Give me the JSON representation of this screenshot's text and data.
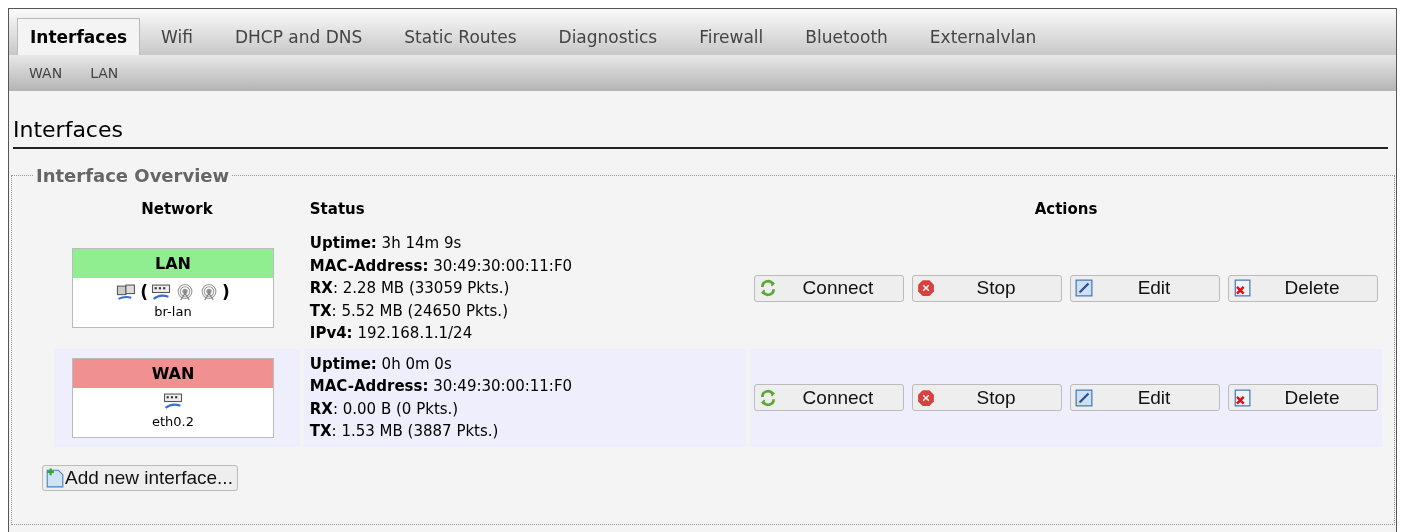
{
  "tabs": [
    {
      "label": "Interfaces",
      "selected": true
    },
    {
      "label": "Wifi",
      "selected": false
    },
    {
      "label": "DHCP and DNS",
      "selected": false
    },
    {
      "label": "Static Routes",
      "selected": false
    },
    {
      "label": "Diagnostics",
      "selected": false
    },
    {
      "label": "Firewall",
      "selected": false
    },
    {
      "label": "Bluetooth",
      "selected": false
    },
    {
      "label": "Externalvlan",
      "selected": false
    }
  ],
  "subtabs": [
    "WAN",
    "LAN"
  ],
  "page_title": "Interfaces",
  "overview": {
    "legend": "Interface Overview",
    "columns": [
      "Network",
      "Status",
      "Actions"
    ],
    "rows": [
      {
        "name": "LAN",
        "color": "#90ee90",
        "bridge": {
          "open": "(",
          "close": ")"
        },
        "devices": [
          {
            "kind": "ethernet"
          },
          {
            "kind": "wireless"
          },
          {
            "kind": "wireless"
          }
        ],
        "device_name": "br-lan",
        "status": [
          "**Uptime:** 3h 14m 9s",
          "**MAC-Address:** 30:49:30:00:11:F0",
          "**RX**: 2.28 MB (33059 Pkts.)",
          "**TX**: 5.52 MB (24650 Pkts.)",
          "**IPv4:** 192.168.1.1/24"
        ],
        "actions": [
          {
            "kind": "connect",
            "label": "Connect"
          },
          {
            "kind": "stop",
            "label": "Stop"
          },
          {
            "kind": "edit",
            "label": "Edit"
          },
          {
            "kind": "delete",
            "label": "Delete"
          }
        ]
      },
      {
        "name": "WAN",
        "color": "#f09090",
        "devices": [
          {
            "kind": "ethernet"
          }
        ],
        "device_name": "eth0.2",
        "status": [
          "**Uptime:** 0h 0m 0s",
          "**MAC-Address:** 30:49:30:00:11:F0",
          "**RX**: 0.00 B (0 Pkts.)",
          "**TX**: 1.53 MB (3887 Pkts.)"
        ],
        "actions": [
          {
            "kind": "connect",
            "label": "Connect"
          },
          {
            "kind": "stop",
            "label": "Stop"
          },
          {
            "kind": "edit",
            "label": "Edit"
          },
          {
            "kind": "delete",
            "label": "Delete"
          }
        ]
      }
    ],
    "add_button": "Add new interface..."
  }
}
